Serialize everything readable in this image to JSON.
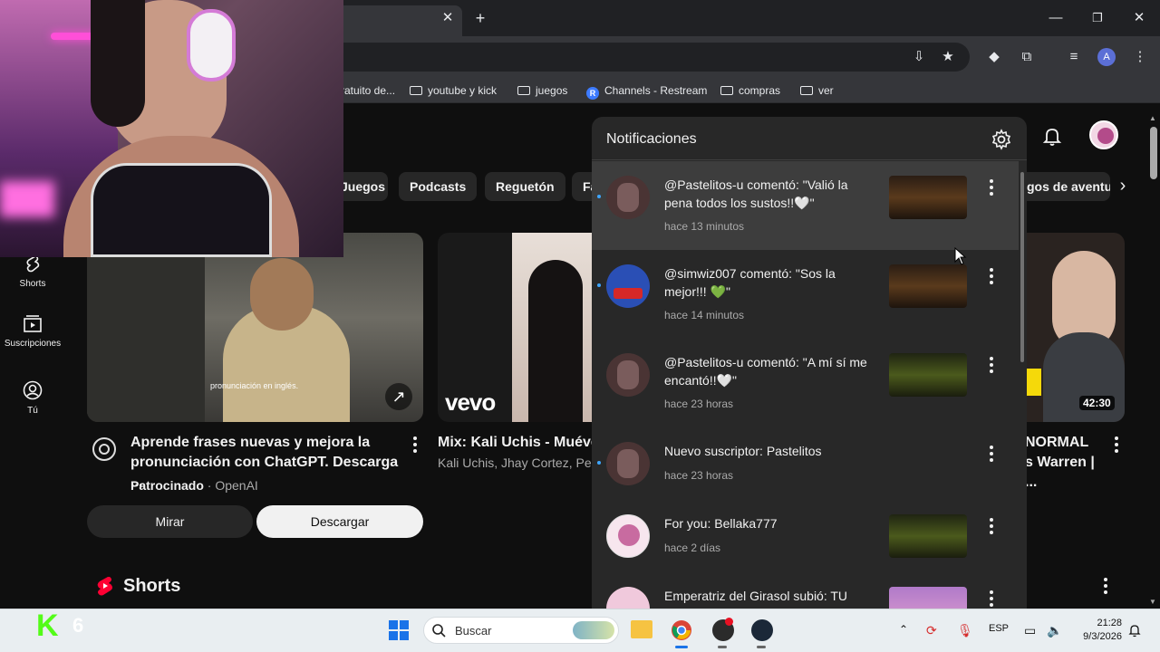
{
  "browser": {
    "bookmarks": [
      {
        "label": "ratuito de..."
      },
      {
        "label": "youtube y kick"
      },
      {
        "label": "juegos"
      },
      {
        "label": "Channels - Restream"
      },
      {
        "label": "compras"
      },
      {
        "label": "ver"
      }
    ],
    "profile_initial": "A"
  },
  "youtube": {
    "chips": [
      "Juegos",
      "Podcasts",
      "Reguetón",
      "Fa",
      "gos de aventur"
    ],
    "sidebar": [
      {
        "label": "Shorts"
      },
      {
        "label": "Suscripciones"
      },
      {
        "label": "Tú"
      }
    ],
    "videos": [
      {
        "title_line1": "Aprende frases nuevas y mejora la",
        "title_line2": "pronunciación con ChatGPT. Descarga ...",
        "sponsored": "Patrocinado",
        "channel": "· OpenAI",
        "subtitle": "pronunciación en inglés.",
        "btn_watch": "Mirar",
        "btn_download": "Descargar"
      },
      {
        "title": "Mix: Kali Uchis - Muével",
        "meta": "Kali Uchis, Jhay Cortez, Pes",
        "brand": "vevo"
      },
      {
        "title_line1": "NORMAL",
        "title_line2": "s Warren | ...",
        "duration": "42:30"
      }
    ],
    "shorts_heading": "Shorts"
  },
  "notifications": {
    "title": "Notificaciones",
    "items": [
      {
        "text": "@Pastelitos-u comentó: \"Valió la pena todos los sustos!!🤍\"",
        "time": "hace 13 minutos",
        "unread": true,
        "highlighted": true
      },
      {
        "text": "@simwiz007 comentó: \"Sos la mejor!!! 💚\"",
        "time": "hace 14 minutos",
        "unread": true
      },
      {
        "text": "@Pastelitos-u comentó: \"A mí sí me encantó!!🤍\"",
        "time": "hace 23 horas",
        "unread": false
      },
      {
        "text": "Nuevo suscriptor: Pastelitos",
        "time": "hace 23 horas",
        "unread": true
      },
      {
        "text": "For you: Bellaka777",
        "time": "hace 2 días",
        "unread": false
      },
      {
        "text": "Emperatriz del Girasol subió: TU",
        "time": "",
        "unread": false
      }
    ]
  },
  "taskbar": {
    "search_placeholder": "Buscar",
    "language": "ESP",
    "time": "21:28",
    "date": "9/3/2026",
    "kick_number": "6"
  },
  "colors": {
    "youtube_red": "#ff0033",
    "unread_dot": "#3ea6ff",
    "kick_green": "#53fc18"
  }
}
